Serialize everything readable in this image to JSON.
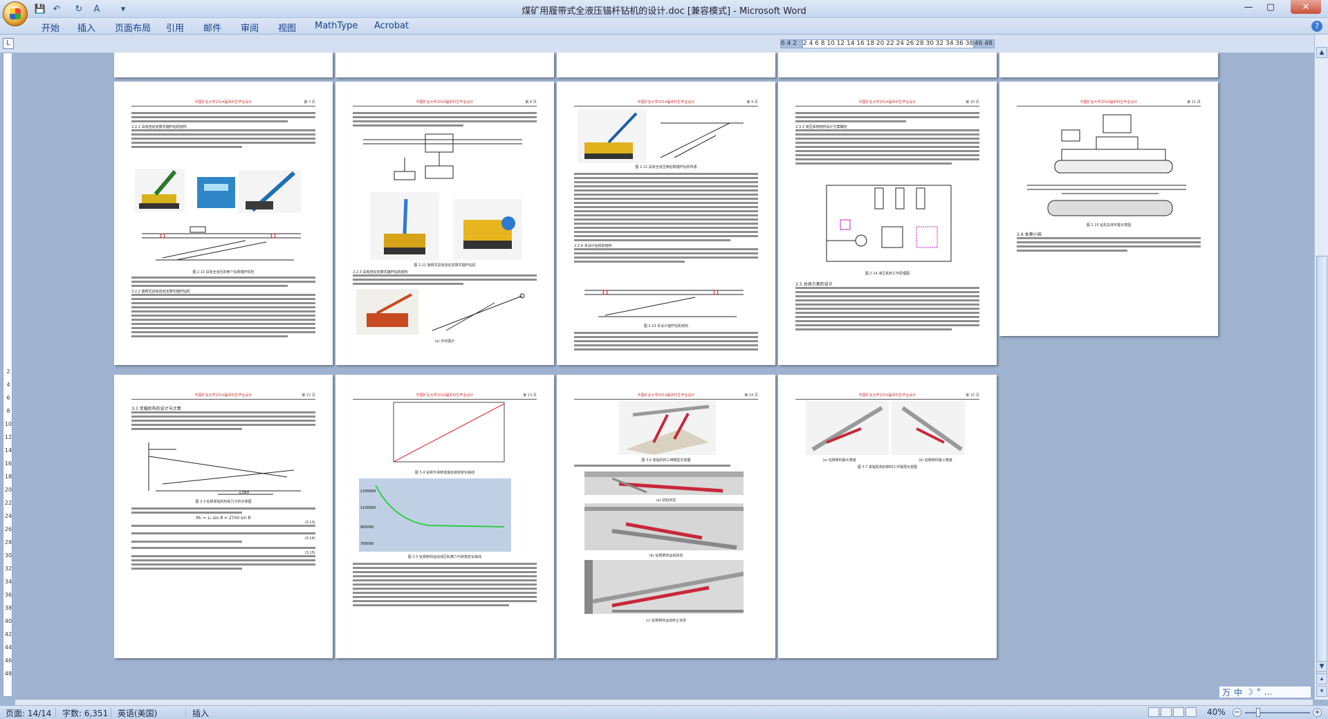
{
  "titlebar": {
    "title": "煤矿用履带式全液压锚杆钻机的设计.doc [兼容模式] - Microsoft Word",
    "qa_save": "💾",
    "qa_undo": "↶",
    "qa_redo": "↻",
    "qa_format": "A",
    "qa_more": "▾",
    "win_min": "—",
    "win_max": "▢",
    "win_close": "✕"
  },
  "tabs": [
    "开始",
    "插入",
    "页面布局",
    "引用",
    "邮件",
    "审阅",
    "视图",
    "MathType",
    "Acrobat"
  ],
  "help_icon": "?",
  "ruler": {
    "corner": "L",
    "left": "6 4 2",
    "main": "2  4  6  8  10 12 14 16 18 20 22 24 26 28 30 32 34 36 38 40 42",
    "right": "46 48"
  },
  "vruler_ticks": [
    "2",
    "4",
    "6",
    "8",
    "10",
    "12",
    "14",
    "16",
    "18",
    "20",
    "22",
    "24",
    "26",
    "28",
    "30",
    "32",
    "34",
    "36",
    "38",
    "40",
    "42",
    "44",
    "46",
    "48"
  ],
  "pages_row1": [
    {
      "header": "中国矿业大学2014届本科生毕业设计",
      "num": "第 7 页",
      "caption1": "图 2.10 具有全液压的两个钻臂锚杆机构",
      "section1": "2.2.1 具有自动支撑式锚杆钻机结构",
      "section2": "2.2.2 旋臂式具有自动支撑式锚杆钻机"
    },
    {
      "header": "中国矿业大学2014届本科生毕业设计",
      "num": "第 8 页",
      "caption1": "图 2.11 旋臂式具有自动支撑式锚杆钻机",
      "section1": "2.2.3 具有自动支撑式锚杆钻机结构",
      "caption2": "(a) 外形图示"
    },
    {
      "header": "中国矿业大学2014届本科生毕业设计",
      "num": "第 9 页",
      "caption1": "图 2.12 具有全液压两钻臂锚杆钻机布置",
      "section1": "2.2.4 本设计钻机的结构",
      "caption2": "图 2.13 本设计锚杆钻机结构"
    },
    {
      "header": "中国矿业大学2014届本科生毕业设计",
      "num": "第 10 页",
      "section1": "2.3.3 液压系统结构设计方案确定",
      "caption1": "图 2.14 液压系统工作原理图",
      "section2": "2.5 总体方案的设计"
    },
    {
      "header": "中国矿业大学2014届本科生毕业设计",
      "num": "第 11 页",
      "caption1": "图 2.15 钻机总体布置示意图",
      "section1": "2.6 本章小结"
    }
  ],
  "pages_row2": [
    {
      "header": "中国矿业大学2014届本科生毕业设计",
      "num": "第 12 页",
      "section1": "3.3 变幅机构的设计与计算",
      "caption1": "图 3.3 钻臂变幅机构受力分析示意图",
      "dim_label": "1390",
      "eq1": "M₀ = L₀ sin θ = 2700 sin θ",
      "eq_no1": "(3.13)",
      "eq_no2": "(3.14)",
      "eq_no3": "(3.15)"
    },
    {
      "header": "中国矿业大学2014届本科生毕业设计",
      "num": "第 13 页",
      "caption1": "图 3.4 钻臂与滑架连接处载荷变化曲线",
      "caption2": "图 3.5 钻臂俯仰运动液压缸推力与转角变化曲线",
      "ytick_top": "1200000",
      "ytick_mid": "1100000",
      "ytick_low": "900000",
      "ytick_bot": "700000"
    },
    {
      "header": "中国矿业大学2014届本科生毕业设计",
      "num": "第 14 页",
      "caption1": "图 3.6 变幅机构三维模型仿真图",
      "caption2": "(a) 初始状态",
      "caption3": "(b) 钻臂俯仰运动状态",
      "caption4": "(c) 钻臂俯仰运动终止状态"
    },
    {
      "header": "中国矿业大学2014届本科生毕业设计",
      "num": "第 15 页",
      "caption1": "(a) 钻臂俯仰最大角度",
      "caption2": "(b) 钻臂俯仰最小角度",
      "caption3": "图 3.7 变幅机构的俯仰工作极限示意图"
    }
  ],
  "statusbar": {
    "page": "页面: 14/14",
    "words": "字数: 6,351",
    "lang": "英语(美国)",
    "mode": "插入",
    "zoom": "40%",
    "zoom_minus": "−",
    "zoom_plus": "+"
  },
  "imebar": {
    "ime1": "万",
    "ime2": "中",
    "ime3": "☽",
    "ime4": "°",
    "ime5": "…"
  },
  "scrollbar": {
    "up": "▲",
    "down": "▼",
    "prev": "▴",
    "next": "▾"
  },
  "colors": {
    "red_curve": "#e0343a",
    "green_curve": "#22cc33",
    "page_bg": "#ffffff",
    "workspace_bg": "#9fb3d0"
  }
}
